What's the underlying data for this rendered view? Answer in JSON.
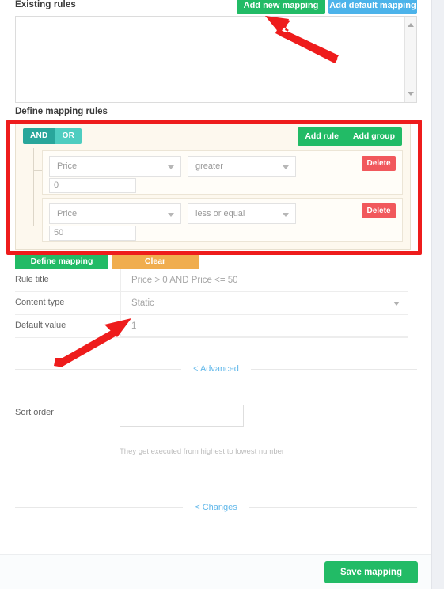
{
  "existing_rules": {
    "label": "Existing rules",
    "add_new_mapping_label": "Add new mapping",
    "add_default_mapping_label": "Add default mapping",
    "textarea_value": "",
    "scrollbar_up_icon": "caret-up-icon",
    "scrollbar_down_icon": "caret-down-icon"
  },
  "define_rules": {
    "label": "Define mapping rules",
    "condition": {
      "and_label": "AND",
      "or_label": "OR",
      "active": "AND"
    },
    "group_actions": {
      "add_rule_label": "Add rule",
      "add_group_label": "Add group"
    },
    "rules": [
      {
        "field": "Price",
        "operator": "greater",
        "value": "0",
        "delete_label": "Delete"
      },
      {
        "field": "Price",
        "operator": "less or equal",
        "value": "50",
        "delete_label": "Delete"
      }
    ]
  },
  "actions": {
    "define_mapping_label": "Define mapping",
    "clear_label": "Clear"
  },
  "form": {
    "rule_title": {
      "label": "Rule title",
      "value": "Price > 0 AND Price <= 50"
    },
    "content_type": {
      "label": "Content type",
      "value": "Static"
    },
    "default_value": {
      "label": "Default value",
      "value": "1"
    }
  },
  "collapse": {
    "advanced_label": "< Advanced",
    "changes_label": "< Changes"
  },
  "advanced": {
    "sort_order_label": "Sort order",
    "sort_order_value": "",
    "sort_order_hint": "They get executed from highest to lowest number"
  },
  "footer": {
    "save_label": "Save mapping"
  },
  "colors": {
    "green": "#22bb66",
    "blue": "#4cb3ea",
    "teal_active": "#29a69b",
    "teal_inactive": "#4ecdc0",
    "red_delete": "#f1585c",
    "orange": "#f0ad4e",
    "annotation_red": "#ee1c1c",
    "link_blue": "#62b8ea",
    "builder_bg": "#fdf8ee"
  }
}
